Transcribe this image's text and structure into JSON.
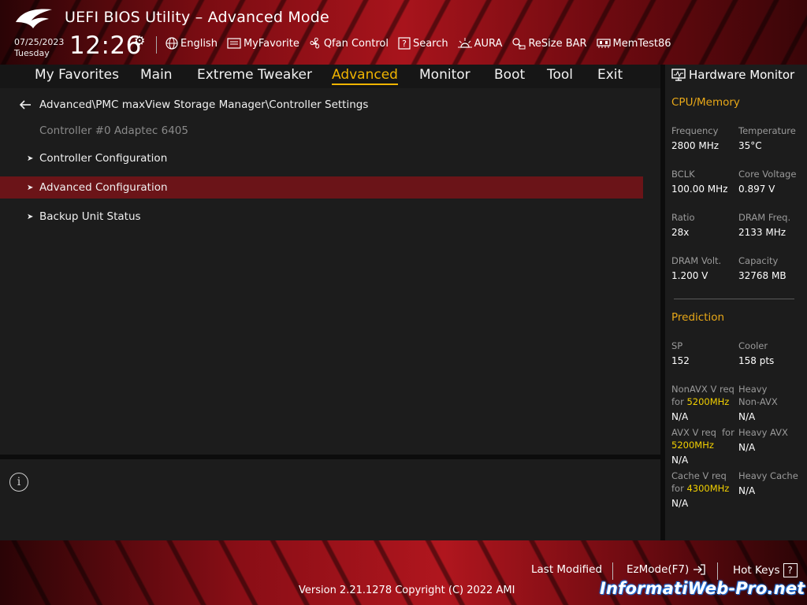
{
  "header": {
    "title": "UEFI BIOS Utility – Advanced Mode",
    "date": "07/25/2023",
    "day": "Tuesday",
    "time": "12:26",
    "toolbar": [
      {
        "label": "English",
        "icon": "globe-icon"
      },
      {
        "label": "MyFavorite",
        "icon": "favorite-icon"
      },
      {
        "label": "Qfan Control",
        "icon": "fan-icon"
      },
      {
        "label": "Search",
        "icon": "search-help-icon"
      },
      {
        "label": "AURA",
        "icon": "aura-icon"
      },
      {
        "label": "ReSize BAR",
        "icon": "resize-bar-icon"
      },
      {
        "label": "MemTest86",
        "icon": "memtest-icon"
      }
    ]
  },
  "menu": {
    "tabs": [
      "My Favorites",
      "Main",
      "Extreme Tweaker",
      "Advanced",
      "Monitor",
      "Boot",
      "Tool",
      "Exit"
    ],
    "active": "Advanced"
  },
  "main": {
    "breadcrumb": "Advanced\\PMC maxView Storage Manager\\Controller Settings",
    "subtitle": "Controller #0 Adaptec 6405",
    "items": [
      {
        "label": "Controller Configuration",
        "selected": false
      },
      {
        "label": "Advanced Configuration",
        "selected": true
      },
      {
        "label": "Backup Unit Status",
        "selected": false
      }
    ]
  },
  "hardware_monitor": {
    "title": "Hardware Monitor",
    "cpu_memory": {
      "heading": "CPU/Memory",
      "frequency_label": "Frequency",
      "frequency": "2800 MHz",
      "temperature_label": "Temperature",
      "temperature": "35°C",
      "bclk_label": "BCLK",
      "bclk": "100.00 MHz",
      "core_voltage_label": "Core Voltage",
      "core_voltage": "0.897 V",
      "ratio_label": "Ratio",
      "ratio": "28x",
      "dram_freq_label": "DRAM Freq.",
      "dram_freq": "2133 MHz",
      "dram_volt_label": "DRAM Volt.",
      "dram_volt": "1.200 V",
      "capacity_label": "Capacity",
      "capacity": "32768 MB"
    },
    "prediction": {
      "heading": "Prediction",
      "sp_label": "SP",
      "sp": "152",
      "cooler_label": "Cooler",
      "cooler": "158 pts",
      "nonavx_label_a": "NonAVX V req",
      "nonavx_label_b": "for",
      "nonavx_freq": "5200MHz",
      "nonavx": "N/A",
      "heavy_nonavx_label_a": "Heavy",
      "heavy_nonavx_label_b": "Non-AVX",
      "heavy_nonavx": "N/A",
      "avx_label_a": "AVX V req",
      "avx_label_b": "for",
      "avx_freq": "5200MHz",
      "avx": "N/A",
      "heavy_avx_label": "Heavy AVX",
      "heavy_avx": "N/A",
      "cache_label_a": "Cache V req",
      "cache_label_b": "for",
      "cache_freq": "4300MHz",
      "cache": "N/A",
      "heavy_cache_label": "Heavy Cache",
      "heavy_cache": "N/A"
    }
  },
  "footer": {
    "last_modified": "Last Modified",
    "ezmode": "EzMode(F7)",
    "hotkeys": "Hot Keys",
    "hotkeys_key": "?",
    "version": "Version 2.21.1278 Copyright (C) 2022 AMI"
  },
  "watermark": "InformatiWeb-Pro.net",
  "colors": {
    "accent": "#f0b400",
    "selected_row": "#6b1418",
    "highlight_value": "#f2d000",
    "section_heading": "#e8a818"
  }
}
